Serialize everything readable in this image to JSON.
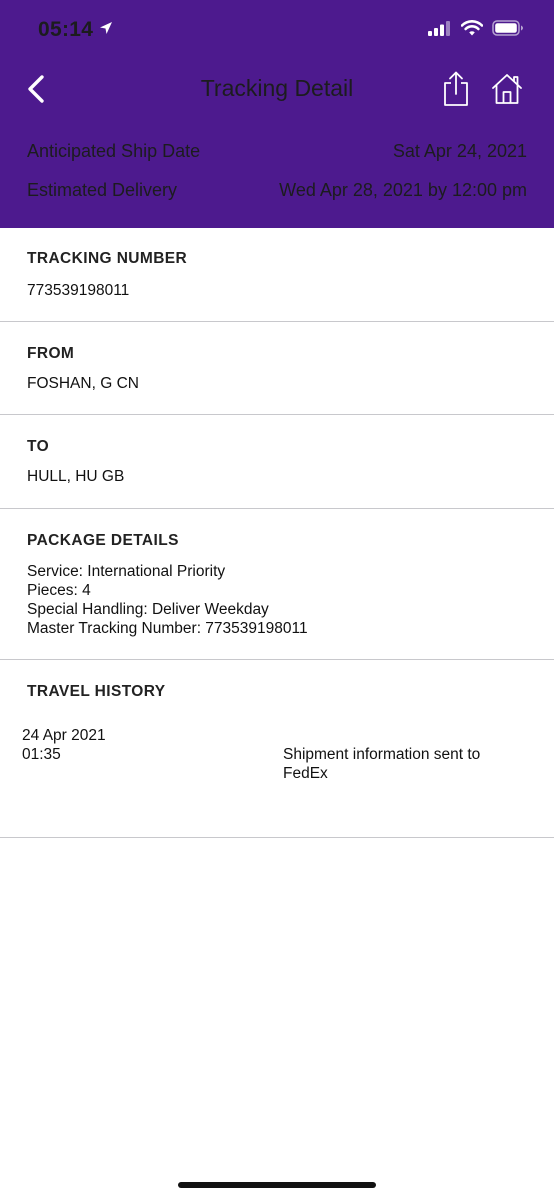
{
  "status_bar": {
    "time": "05:14",
    "icons": [
      "location-arrow-icon",
      "cellular-signal-icon",
      "wifi-icon",
      "battery-icon"
    ]
  },
  "nav": {
    "title": "Tracking Detail",
    "icons": [
      "back-chevron-icon",
      "share-icon",
      "home-icon"
    ]
  },
  "summary": {
    "ship_date_label": "Anticipated Ship Date",
    "ship_date_value": "Sat Apr 24, 2021",
    "delivery_label": "Estimated Delivery",
    "delivery_value": "Wed Apr 28, 2021 by 12:00 pm"
  },
  "tracking": {
    "heading": "TRACKING NUMBER",
    "value": "773539198011"
  },
  "from": {
    "heading": "FROM",
    "value": "FOSHAN, G CN"
  },
  "to": {
    "heading": "TO",
    "value": "HULL, HU GB"
  },
  "package": {
    "heading": "PACKAGE DETAILS",
    "lines": [
      "Service: International Priority",
      "Pieces: 4",
      "Special Handling: Deliver Weekday",
      "Master Tracking Number: 773539198011"
    ]
  },
  "history": {
    "heading": "TRAVEL HISTORY",
    "entries": [
      {
        "date": "24 Apr 2021",
        "time": "01:35",
        "event": "Shipment information sent to FedEx"
      }
    ]
  },
  "colors": {
    "header_purple": "#4d1a8e",
    "divider": "#c8c8cc"
  }
}
